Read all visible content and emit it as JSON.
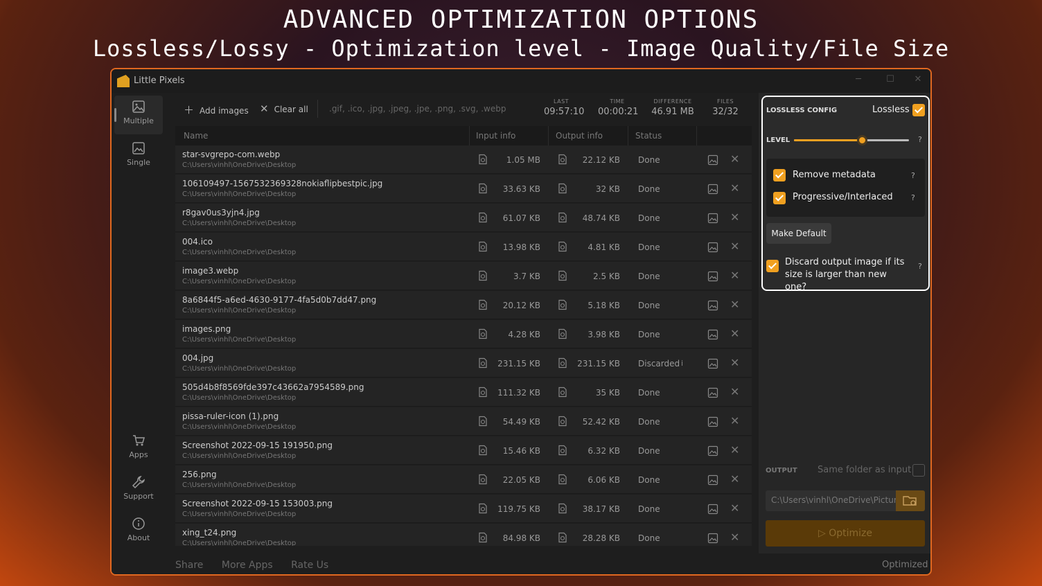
{
  "hero": {
    "title": "ADVANCED OPTIMIZATION OPTIONS",
    "subtitle": "Lossless/Lossy - Optimization level - Image Quality/File Size"
  },
  "app": {
    "title": "Little Pixels"
  },
  "sidebar": {
    "items": [
      {
        "label": "Multiple",
        "icon": "image-icon"
      },
      {
        "label": "Single",
        "icon": "image-icon"
      },
      {
        "label": "Apps",
        "icon": "cart-icon"
      },
      {
        "label": "Support",
        "icon": "wrench-icon"
      },
      {
        "label": "About",
        "icon": "info-icon"
      }
    ]
  },
  "toolbar": {
    "add_label": "Add images",
    "clear_label": "Clear all",
    "extensions": ".gif, .ico, .jpg, .jpeg, .jpe, .png, .svg, .webp",
    "stats": [
      {
        "key": "LAST",
        "value": "09:57:10"
      },
      {
        "key": "TIME",
        "value": "00:00:21"
      },
      {
        "key": "DIFFERENCE",
        "value": "46.91 MB"
      },
      {
        "key": "FILES",
        "value": "32/32"
      }
    ]
  },
  "table": {
    "headers": {
      "name": "Name",
      "input": "Input info",
      "output": "Output info",
      "status": "Status"
    },
    "rows": [
      {
        "name": "star-svgrepo-com.webp",
        "path": "C:\\Users\\vinhl\\OneDrive\\Desktop",
        "input": "1.05 MB",
        "output": "22.12 KB",
        "status": "Done"
      },
      {
        "name": "106109497-1567532369328nokiaflipbestpic.jpg",
        "path": "C:\\Users\\vinhl\\OneDrive\\Desktop",
        "input": "33.63 KB",
        "output": "32 KB",
        "status": "Done"
      },
      {
        "name": "r8gav0us3yjn4.jpg",
        "path": "C:\\Users\\vinhl\\OneDrive\\Desktop",
        "input": "61.07 KB",
        "output": "48.74 KB",
        "status": "Done"
      },
      {
        "name": "004.ico",
        "path": "C:\\Users\\vinhl\\OneDrive\\Desktop",
        "input": "13.98 KB",
        "output": "4.81 KB",
        "status": "Done"
      },
      {
        "name": "image3.webp",
        "path": "C:\\Users\\vinhl\\OneDrive\\Desktop",
        "input": "3.7 KB",
        "output": "2.5 KB",
        "status": "Done"
      },
      {
        "name": "8a6844f5-a6ed-4630-9177-4fa5d0b7dd47.png",
        "path": "C:\\Users\\vinhl\\OneDrive\\Desktop",
        "input": "20.12 KB",
        "output": "5.18 KB",
        "status": "Done"
      },
      {
        "name": "images.png",
        "path": "C:\\Users\\vinhl\\OneDrive\\Desktop",
        "input": "4.28 KB",
        "output": "3.98 KB",
        "status": "Done"
      },
      {
        "name": "004.jpg",
        "path": "C:\\Users\\vinhl\\OneDrive\\Desktop",
        "input": "231.15 KB",
        "output": "231.15 KB",
        "status": "Discarded",
        "info": "i"
      },
      {
        "name": "505d4b8f8569fde397c43662a7954589.png",
        "path": "C:\\Users\\vinhl\\OneDrive\\Desktop",
        "input": "111.32 KB",
        "output": "35 KB",
        "status": "Done"
      },
      {
        "name": "pissa-ruler-icon (1).png",
        "path": "C:\\Users\\vinhl\\OneDrive\\Desktop",
        "input": "54.49 KB",
        "output": "52.42 KB",
        "status": "Done"
      },
      {
        "name": "Screenshot 2022-09-15 191950.png",
        "path": "C:\\Users\\vinhl\\OneDrive\\Desktop",
        "input": "15.46 KB",
        "output": "6.32 KB",
        "status": "Done"
      },
      {
        "name": "256.png",
        "path": "C:\\Users\\vinhl\\OneDrive\\Desktop",
        "input": "22.05 KB",
        "output": "6.06 KB",
        "status": "Done"
      },
      {
        "name": "Screenshot 2022-09-15 153003.png",
        "path": "C:\\Users\\vinhl\\OneDrive\\Desktop",
        "input": "119.75 KB",
        "output": "38.17 KB",
        "status": "Done"
      },
      {
        "name": "xing_t24.png",
        "path": "C:\\Users\\vinhl\\OneDrive\\Desktop",
        "input": "84.98 KB",
        "output": "28.28 KB",
        "status": "Done"
      }
    ]
  },
  "footer": {
    "share": "Share",
    "more_apps": "More Apps",
    "rate_us": "Rate Us",
    "optimized": "Optimized"
  },
  "config": {
    "title": "LOSSLESS CONFIG",
    "mode_label": "Lossless",
    "level_label": "LEVEL",
    "level_fraction": 0.59,
    "help": "?",
    "remove_metadata": "Remove metadata",
    "progressive": "Progressive/Interlaced",
    "make_default": "Make Default",
    "discard_text": "Discard output image if its size is larger than new one?"
  },
  "output": {
    "label": "OUTPUT",
    "same_folder": "Same folder as input",
    "path": "C:\\Users\\vinhl\\OneDrive\\Pictures",
    "optimize_label": "Optimize"
  },
  "colors": {
    "accent": "#f0a020",
    "border": "#e06820"
  }
}
